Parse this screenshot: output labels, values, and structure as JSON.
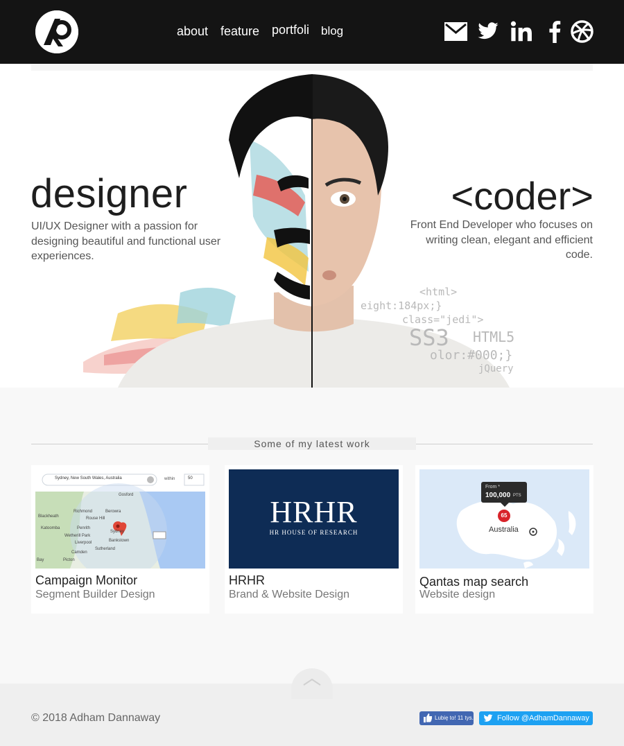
{
  "header": {
    "nav": [
      {
        "label": "about"
      },
      {
        "label": "feature"
      },
      {
        "label": "portfoli"
      },
      {
        "label": "blog"
      }
    ],
    "social_icons": [
      "mail-icon",
      "twitter-icon",
      "linkedin-icon",
      "facebook-icon",
      "dribbble-icon"
    ]
  },
  "hero": {
    "left_title": "designer",
    "left_description": "UI/UX Designer with a passion for designing beautiful and functional user experiences.",
    "right_title": "<coder>",
    "right_description": "Front End Developer who focuses on writing clean, elegant and efficient code.",
    "code_snippets": [
      "<html>",
      "eight:184px;}",
      "class=\"jedi\">",
      "SS3",
      "HTML5",
      "olor:#000;}",
      "jQuery"
    ]
  },
  "work": {
    "section_title": "Some of my latest work",
    "items": [
      {
        "title": "Campaign Monitor",
        "subtitle": "Segment Builder Design",
        "thumb": {
          "search_text": "Sydney, New South Wales, Australia",
          "within_label": "within",
          "within_value": "50",
          "places": [
            "Gosford",
            "Richmond",
            "Berowra",
            "Blackheath",
            "Rouse Hill",
            "Katoomba",
            "Penrith",
            "Sydney",
            "Wetherill Park",
            "Bankstown",
            "Liverpool",
            "Sutherland",
            "Camden",
            "Picton",
            "Bay"
          ]
        }
      },
      {
        "title": "HRHR",
        "subtitle": "Brand & Website Design",
        "thumb": {
          "logo": "HRHR",
          "tagline": "HR HOUSE OF RESEARCH"
        }
      },
      {
        "title": "Qantas map search",
        "subtitle": "Website design",
        "thumb": {
          "tooltip_from": "From *",
          "tooltip_points": "100,000",
          "tooltip_unit": "PTS",
          "marker_count": "65",
          "country": "Australia"
        }
      }
    ]
  },
  "footer": {
    "copyright": "© 2018 Adham Dannaway",
    "facebook_button": "Lubię to! 11 tys.",
    "twitter_button": "Follow @AdhamDannaway"
  },
  "colors": {
    "header_bg": "#141414",
    "twitter": "#1da1f2",
    "facebook": "#4267b2",
    "hrhr_navy": "#0e2c55",
    "map_water": "#dbe9f8"
  }
}
